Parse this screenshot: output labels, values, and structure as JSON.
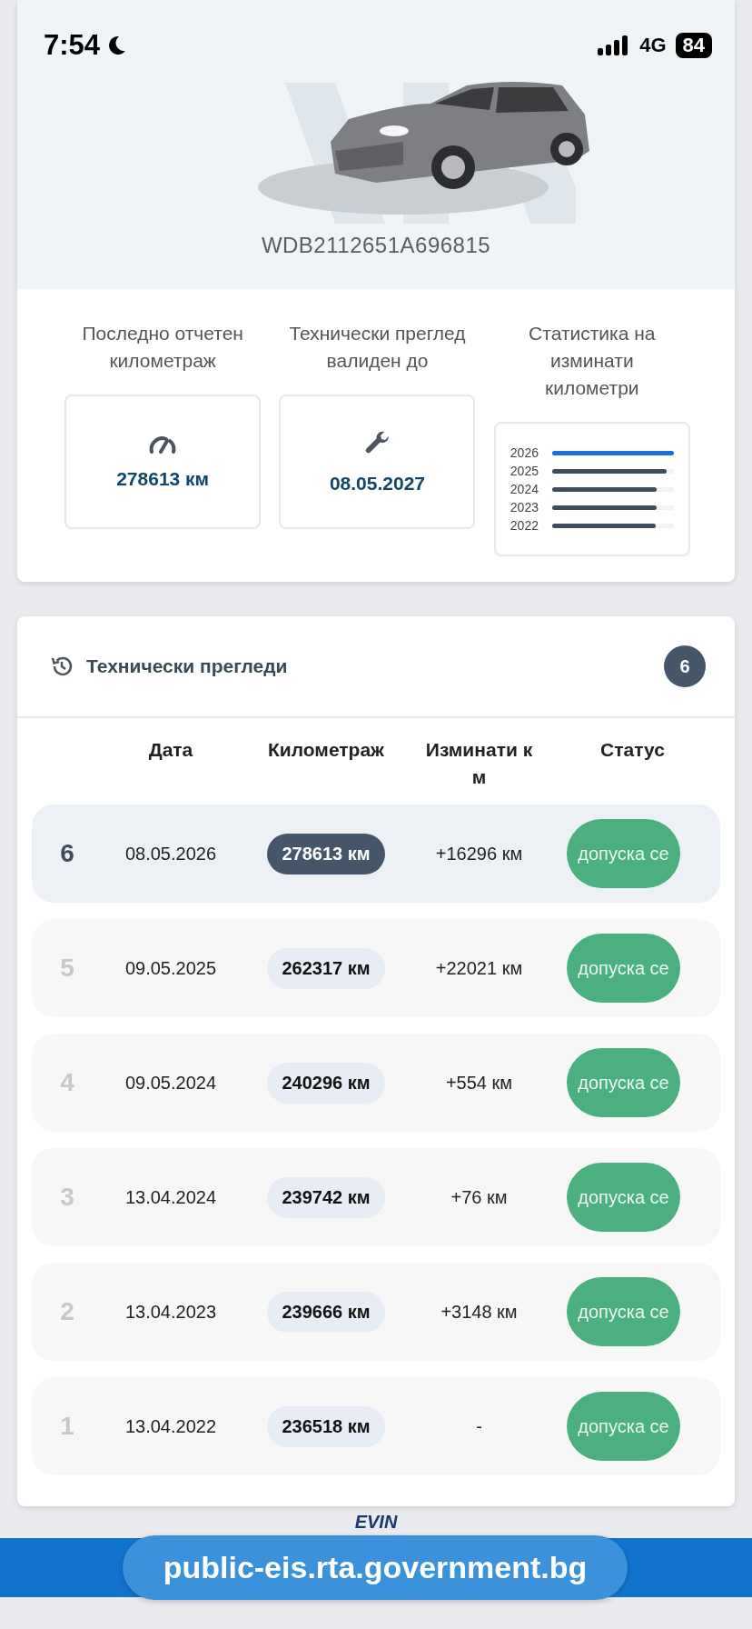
{
  "status_bar": {
    "time": "7:54",
    "network": "4G",
    "battery": "84"
  },
  "vehicle": {
    "vin": "WDB2112651A696815"
  },
  "stats": [
    {
      "kind": "mileage",
      "label": "Последно отчетен километраж",
      "value": "278613 км"
    },
    {
      "kind": "inspection",
      "label": "Технически преглед валиден до",
      "value": "08.05.2027"
    }
  ],
  "mileage_stats": {
    "label": "Статистика на изминати километри",
    "years": [
      {
        "year": "2026",
        "level": 1.0,
        "color": "#1a6fe0"
      },
      {
        "year": "2025",
        "level": 0.94,
        "color": "#3f4c5c"
      },
      {
        "year": "2024",
        "level": 0.86,
        "color": "#3f4c5c"
      },
      {
        "year": "2023",
        "level": 0.86,
        "color": "#3f4c5c"
      },
      {
        "year": "2022",
        "level": 0.85,
        "color": "#3f4c5c"
      }
    ]
  },
  "inspections": {
    "title": "Технически прегледи",
    "count": "6",
    "columns": [
      "Дата",
      "Километраж",
      "Изминати км",
      "Статус"
    ],
    "rows": [
      {
        "index": "6",
        "date": "08.05.2026",
        "mileage": "278613 км",
        "delta": "+16296 км",
        "status": "допуска се",
        "selected": true
      },
      {
        "index": "5",
        "date": "09.05.2025",
        "mileage": "262317 км",
        "delta": "+22021 км",
        "status": "допуска се",
        "selected": false
      },
      {
        "index": "4",
        "date": "09.05.2024",
        "mileage": "240296 км",
        "delta": "+554 км",
        "status": "допуска се",
        "selected": false
      },
      {
        "index": "3",
        "date": "13.04.2024",
        "mileage": "239742 км",
        "delta": "+76 км",
        "status": "допуска се",
        "selected": false
      },
      {
        "index": "2",
        "date": "13.04.2023",
        "mileage": "239666 км",
        "delta": "+3148 км",
        "status": "допуска се",
        "selected": false
      },
      {
        "index": "1",
        "date": "13.04.2022",
        "mileage": "236518 км",
        "delta": "-",
        "status": "допуска се",
        "selected": false
      }
    ]
  },
  "footer": {
    "logo": "EVIN",
    "url": "public-eis.rta.government.bg"
  }
}
